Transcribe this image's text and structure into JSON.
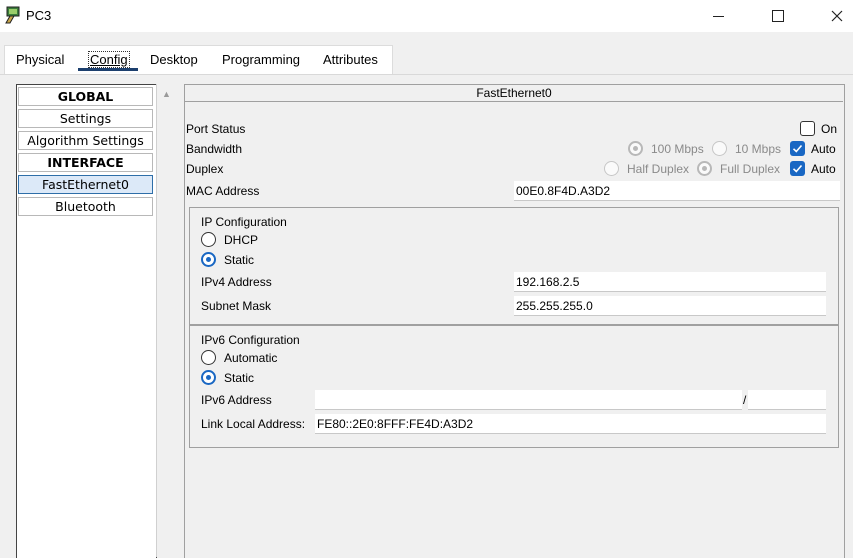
{
  "window": {
    "title": "PC3",
    "minimize_glyph": "—",
    "maximize_glyph": "☐",
    "close_glyph": "✕"
  },
  "tabs": [
    {
      "label": "Physical"
    },
    {
      "label": "Config",
      "selected": true
    },
    {
      "label": "Desktop"
    },
    {
      "label": "Programming"
    },
    {
      "label": "Attributes"
    }
  ],
  "sidebar": {
    "items": [
      {
        "label": "GLOBAL",
        "type": "header"
      },
      {
        "label": "Settings"
      },
      {
        "label": "Algorithm Settings"
      },
      {
        "label": "INTERFACE",
        "type": "header"
      },
      {
        "label": "FastEthernet0",
        "selected": true
      },
      {
        "label": "Bluetooth"
      }
    ],
    "scroll_up_glyph": "▲"
  },
  "panel": {
    "title": "FastEthernet0",
    "port_status": {
      "label": "Port Status",
      "on_label": "On",
      "on_checked": false
    },
    "bandwidth": {
      "label": "Bandwidth",
      "opt1": "100 Mbps",
      "opt2": "10 Mbps",
      "auto_label": "Auto",
      "auto_checked": true
    },
    "duplex": {
      "label": "Duplex",
      "opt1": "Half Duplex",
      "opt2": "Full Duplex",
      "auto_label": "Auto",
      "auto_checked": true
    },
    "mac": {
      "label": "MAC Address",
      "value": "00E0.8F4D.A3D2"
    },
    "ipv4": {
      "title": "IP Configuration",
      "dhcp_label": "DHCP",
      "static_label": "Static",
      "mode": "Static",
      "address_label": "IPv4 Address",
      "address": "192.168.2.5",
      "mask_label": "Subnet Mask",
      "mask": "255.255.255.0"
    },
    "ipv6": {
      "title": "IPv6 Configuration",
      "auto_label": "Automatic",
      "static_label": "Static",
      "mode": "Static",
      "address_label": "IPv6 Address",
      "address": "",
      "prefix_sep": "/",
      "prefix": "",
      "link_local_label": "Link Local Address:",
      "link_local": "FE80::2E0:8FFF:FE4D:A3D2"
    }
  },
  "colors": {
    "accent": "#1967c3",
    "tab_underline": "#1c3f6e",
    "selected_item": "#dce9f8"
  }
}
